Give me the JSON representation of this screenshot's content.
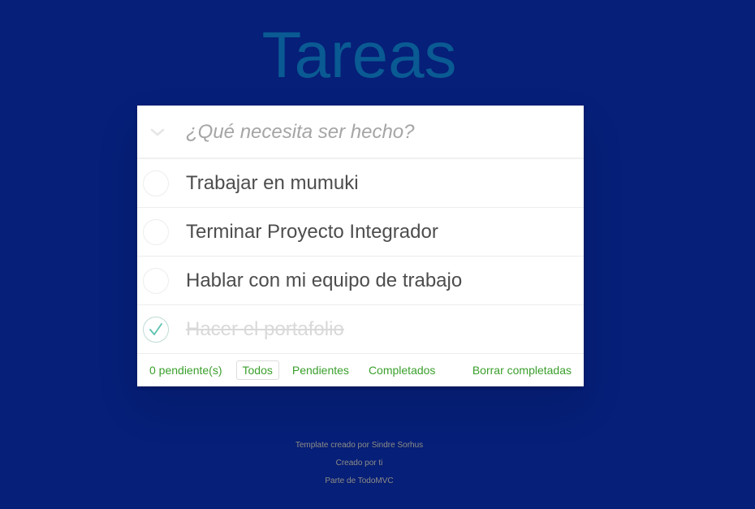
{
  "header": {
    "title": "Tareas"
  },
  "new_todo": {
    "placeholder": "¿Qué necesita ser hecho?",
    "value": ""
  },
  "todos": [
    {
      "label": "Trabajar en mumuki",
      "completed": false
    },
    {
      "label": "Terminar Proyecto Integrador",
      "completed": false
    },
    {
      "label": "Hablar con mi equipo de trabajo",
      "completed": false
    },
    {
      "label": "Hacer el portafolio",
      "completed": true
    }
  ],
  "footer": {
    "count": "0 pendiente(s)",
    "filters": [
      "Todos",
      "Pendientes",
      "Completados"
    ],
    "selected_filter": "Todos",
    "clear": "Borrar completadas"
  },
  "info": {
    "line1": "Template creado por Sindre Sorhus",
    "line2": "Creado por ti",
    "line3": "Parte de TodoMVC"
  },
  "colors": {
    "background": "#061f78",
    "title": "#0a5a93",
    "link": "#3a9f2c",
    "check": "#5dc2af"
  },
  "icons": {
    "toggle_all": "chevron-down-icon",
    "check": "checkmark-icon"
  }
}
